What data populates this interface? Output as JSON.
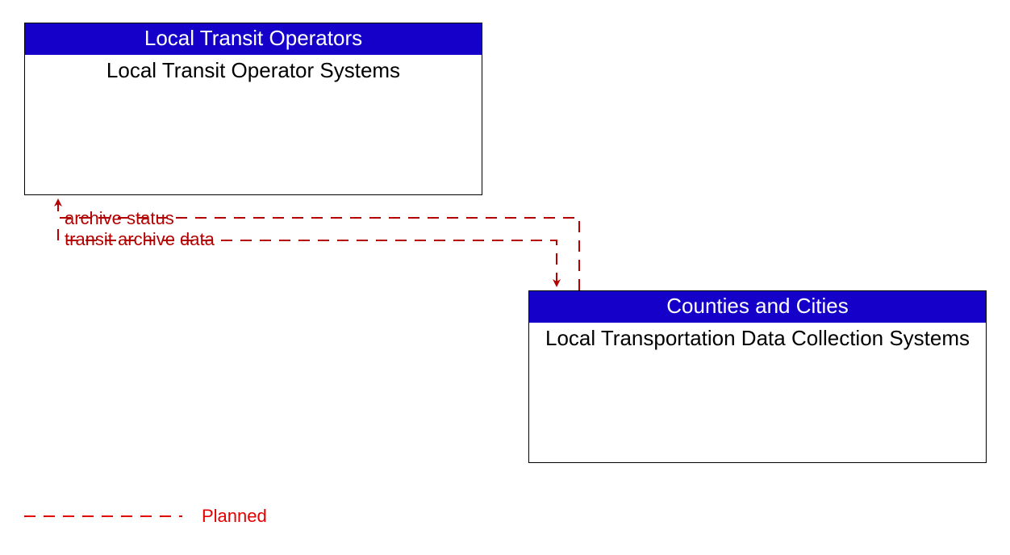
{
  "boxes": {
    "top": {
      "header": "Local Transit Operators",
      "body": "Local Transit Operator Systems"
    },
    "bottom": {
      "header": "Counties and Cities",
      "body": "Local Transportation Data Collection Systems"
    }
  },
  "flows": {
    "archive_status": "archive status",
    "transit_archive_data": "transit archive data"
  },
  "legend": {
    "planned": "Planned"
  },
  "colors": {
    "header_bg": "#1400c8",
    "flow_line": "#b30000",
    "legend_text": "#e60000"
  }
}
